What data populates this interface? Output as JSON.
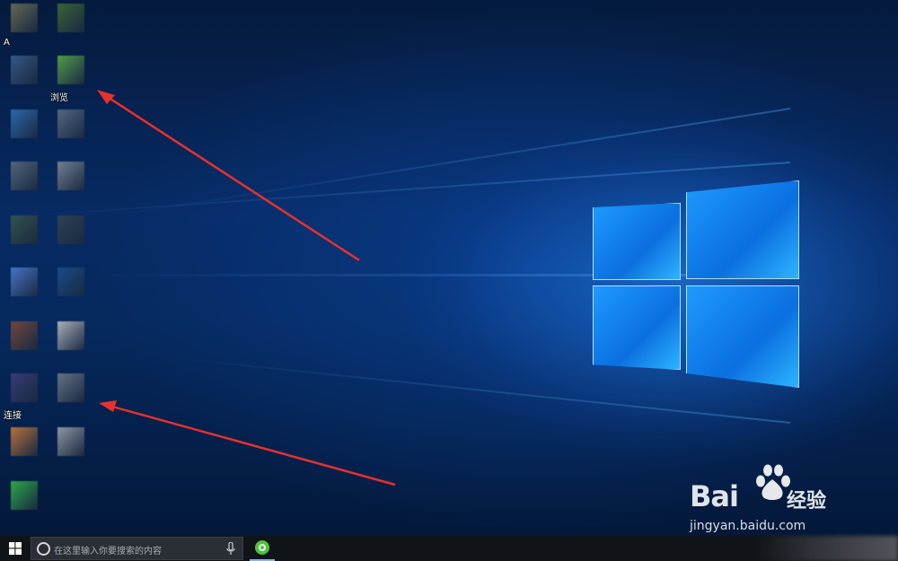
{
  "desktop": {
    "icons": [
      {
        "label": "A",
        "color": "#6b6f57"
      },
      {
        "label": "",
        "color": "#3e6a3a"
      },
      {
        "label": "",
        "color": "#3a5d8c"
      },
      {
        "label": "浏览",
        "color": "#5aa64a"
      },
      {
        "label": "",
        "color": "#2f6fb7"
      },
      {
        "label": "",
        "color": "#5b6e86"
      },
      {
        "label": "",
        "color": "#5c6b7d"
      },
      {
        "label": "",
        "color": "#7d8896"
      },
      {
        "label": "",
        "color": "#37574d"
      },
      {
        "label": "",
        "color": "#334456"
      },
      {
        "label": "",
        "color": "#4e7bd2"
      },
      {
        "label": "",
        "color": "#1c4f8f"
      },
      {
        "label": "",
        "color": "#7a4a3c"
      },
      {
        "label": "",
        "color": "#b9bcc2"
      },
      {
        "label": "连接",
        "color": "#3b3f78"
      },
      {
        "label": "",
        "color": "#6f7a8a"
      },
      {
        "label": "",
        "color": "#c47a3a"
      },
      {
        "label": "",
        "color": "#9aa1ac"
      },
      {
        "label": "",
        "color": "#31b54b"
      }
    ]
  },
  "taskbar": {
    "search_placeholder": "在这里输入你要搜索的内容",
    "pinned_app": "green-browser-icon"
  },
  "watermark": {
    "brand": "Bai",
    "brand_suffix": "经验",
    "url": "jingyan.baidu.com"
  },
  "colors": {
    "arrow": "#e8312b",
    "taskbar": "#101418",
    "accent": "#7bb5ff"
  }
}
